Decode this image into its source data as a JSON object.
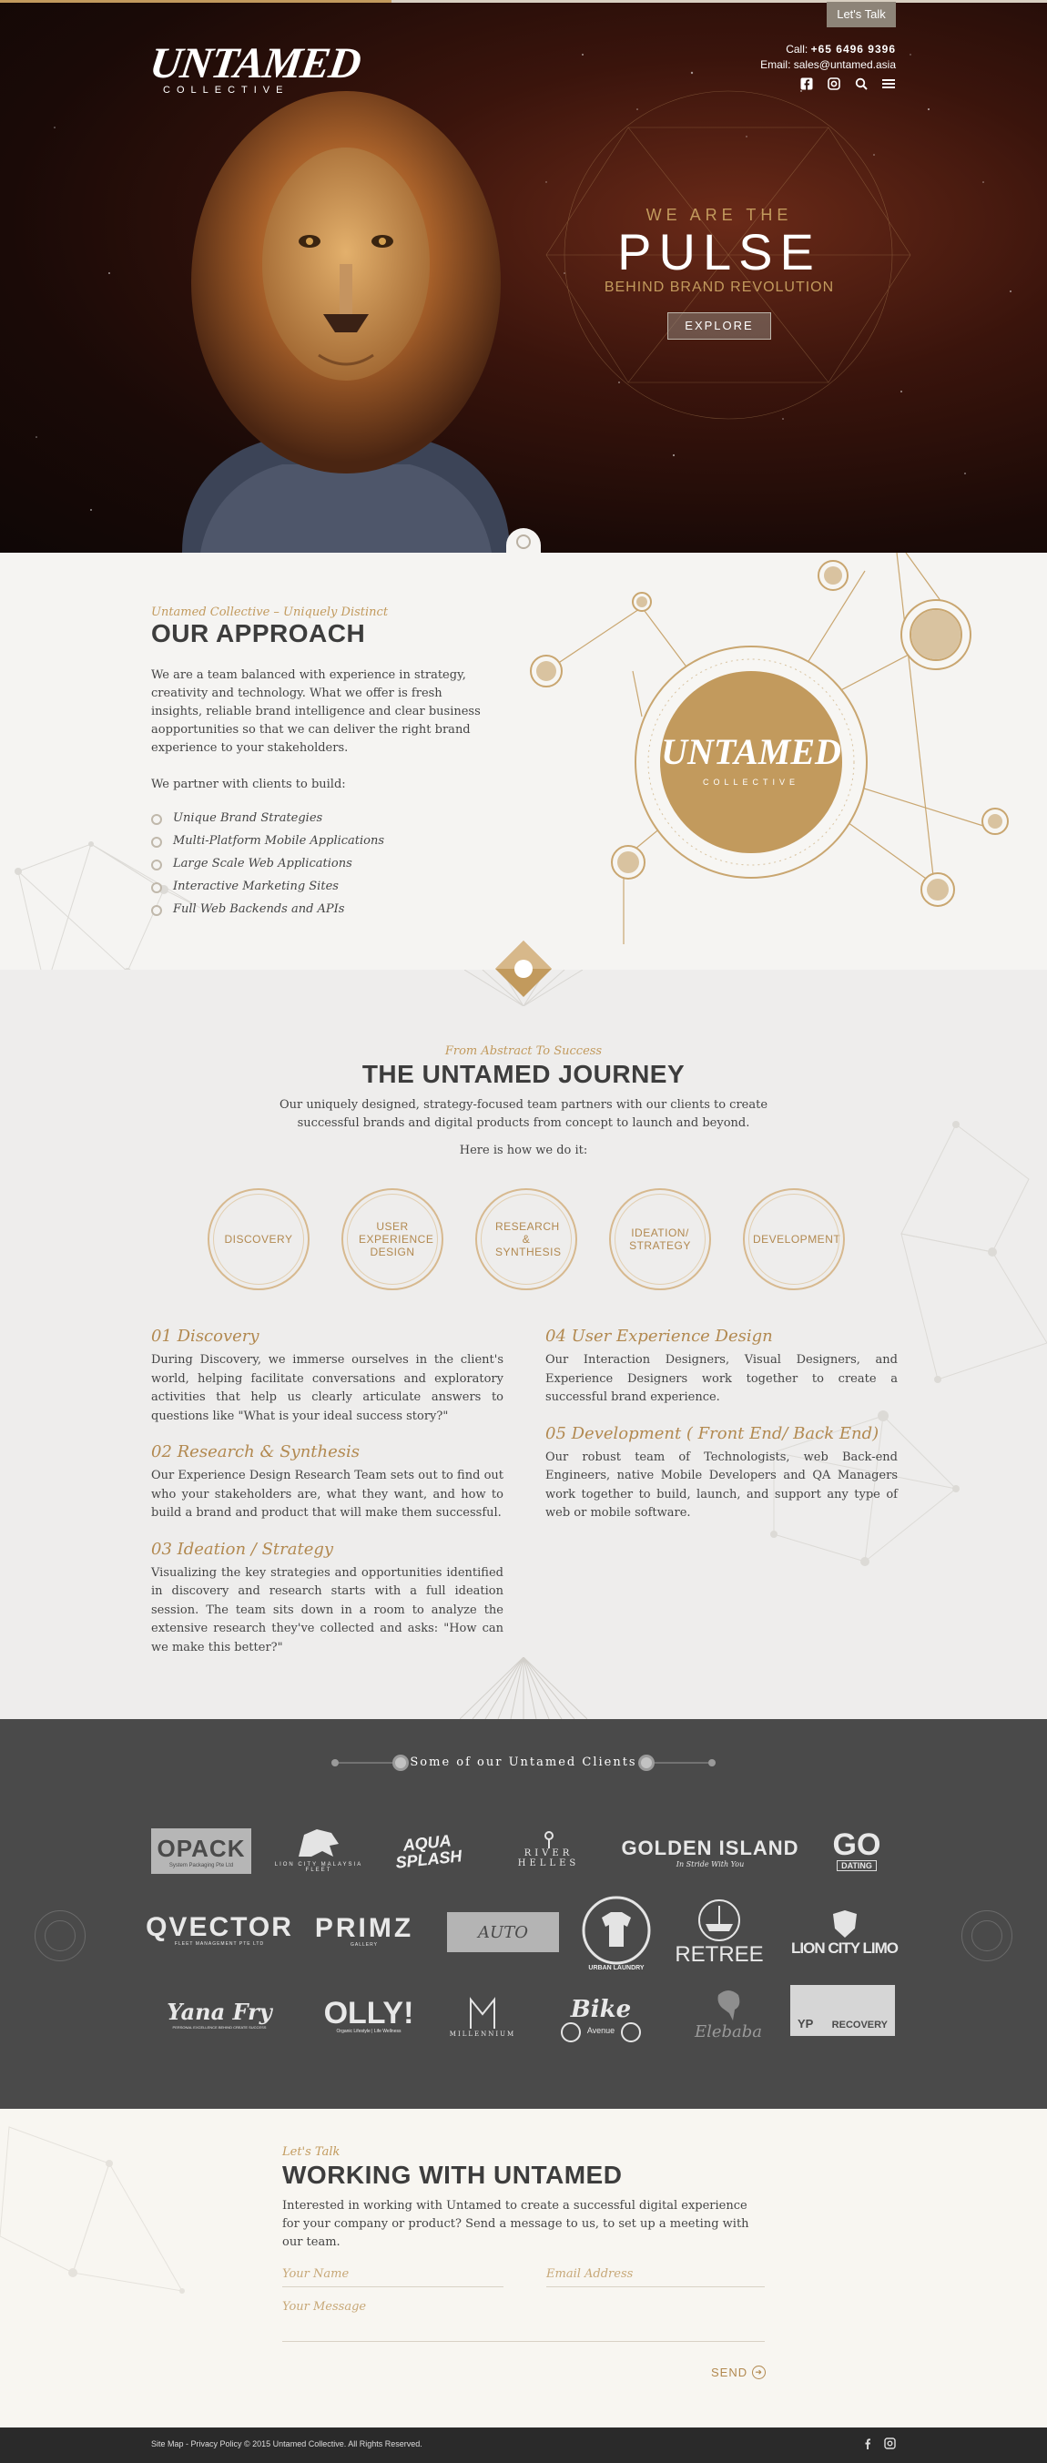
{
  "header": {
    "lets_talk": "Let's Talk",
    "logo_main": "UNTAMED",
    "logo_sub": "COLLECTIVE",
    "call_label": "Call:",
    "phone": "+65 6496 9396",
    "email_label": "Email:",
    "email": "sales@untamed.asia",
    "icons": [
      "facebook-icon",
      "instagram-icon",
      "search-icon",
      "menu-icon"
    ]
  },
  "hero": {
    "eyebrow": "WE ARE THE",
    "title": "PULSE",
    "subtitle": "BEHIND BRAND REVOLUTION",
    "cta": "EXPLORE"
  },
  "approach": {
    "eyebrow": "Untamed Collective – Uniquely Distinct",
    "title": "OUR APPROACH",
    "body": "We are a team balanced with experience in strategy, creativity and technology. What we offer is fresh insights, reliable brand intelligence and clear business aopportunities so that we can deliver the right brand experience to your stakeholders.",
    "partner_intro": "We partner with clients to build:",
    "list": [
      "Unique Brand Strategies",
      "Multi-Platform Mobile Applications",
      "Large Scale Web Applications",
      "Interactive Marketing Sites",
      "Full Web Backends and APIs"
    ],
    "badge_main": "UNTAMED",
    "badge_sub": "COLLECTIVE"
  },
  "journey": {
    "eyebrow": "From Abstract To Success",
    "title": "THE UNTAMED JOURNEY",
    "body": "Our uniquely designed, strategy-focused team partners with our clients to create successful brands and digital products from concept to launch and beyond.",
    "how": "Here is how we do it:",
    "steps": [
      "DISCOVERY",
      "USER EXPERIENCE DESIGN",
      "RESEARCH & SYNTHESIS",
      "IDEATION/ STRATEGY",
      "DEVELOPMENT"
    ],
    "sections": [
      {
        "title": "01 Discovery",
        "text": "During Discovery, we immerse ourselves in the client's world, helping facilitate conversations and exploratory activities that help us clearly articulate answers to questions like \"What is your ideal success story?\""
      },
      {
        "title": "02 Research & Synthesis",
        "text": "Our Experience Design Research Team sets out to find out who your stakeholders are, what they want, and how to build a brand and product that will make them successful."
      },
      {
        "title": "03 Ideation / Strategy",
        "text": "Visualizing the key strategies and opportunities identified in discovery and research starts with a full ideation session. The team sits down in a room to analyze the extensive research they've collected and asks: \"How can we make this better?\""
      },
      {
        "title": "04 User Experience Design",
        "text": "Our Interaction Designers, Visual Designers, and Experience Designers work together to create a successful brand experience."
      },
      {
        "title": "05 Development ( Front End/ Back End)",
        "text": "Our robust team of Technologists, web Back-end Engineers, native Mobile Developers and QA Managers work together to build, launch, and support any type of web or mobile software."
      }
    ]
  },
  "clients": {
    "title": "Some of our Untamed Clients",
    "logos": {
      "opack": "OPACK",
      "opack_sub": "System Packaging Pte Ltd",
      "lion_city_malaysia": "LION CITY MALAYSIA FLEET",
      "aqua_splash": "AQUA SPLASH",
      "river_helles": "RIVER HELLES",
      "golden_island": "GOLDEN ISLAND",
      "golden_island_sub": "In Stride With You",
      "go_dating": "GO",
      "go_dating_sub": "DATING",
      "qvector": "QVECTOR",
      "qvector_sub": "FLEET MANAGEMENT PTE LTD",
      "primz": "PRIMZ",
      "primz_sub": "GALLERY",
      "auto": "AUTO",
      "urban_laundry": "URBAN LAUNDRY",
      "retree": "RETREE",
      "lion_city_limo": "LION CITY LIMO",
      "yana_fry": "Yana Fry",
      "yana_fry_sub": "PERSONAL EXCELLENCE BEHIND CREATE SUCCESS",
      "olly": "OLLY!",
      "olly_sub": "Organic Lifestyle | Life Wellness",
      "millennium": "MILLENNIUM",
      "bike_avenue": "Bike",
      "bike_avenue_sub": "Avenue",
      "elebaba": "Elebaba",
      "yp_recovery_left": "YP",
      "yp_recovery_right": "RECOVERY"
    }
  },
  "contact": {
    "eyebrow": "Let's Talk",
    "title": "WORKING WITH UNTAMED",
    "body": "Interested in working with Untamed to create a successful digital experience for your company or product? Send a message to us, to set up a meeting with our team.",
    "name_placeholder": "Your Name",
    "email_placeholder": "Email Address",
    "message_placeholder": "Your Message",
    "send": "SEND"
  },
  "footer": {
    "text": "Site Map - Privacy Policy © 2015 Untamed Collective. All Rights Reserved.",
    "icons": [
      "facebook-icon",
      "instagram-icon"
    ]
  },
  "colors": {
    "gold": "#c29a5d",
    "dark": "#4a4a4a",
    "footer": "#2a2a2a"
  }
}
